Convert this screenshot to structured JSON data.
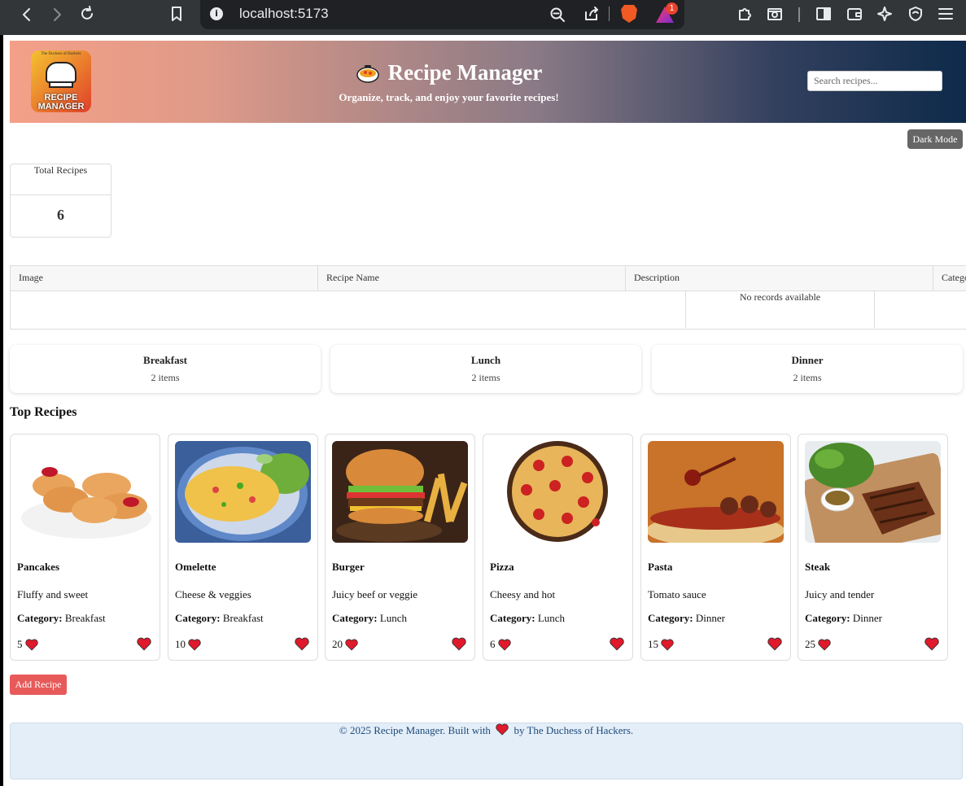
{
  "browser": {
    "url": "localhost:5173",
    "notification_count": "1"
  },
  "header": {
    "logo_small_text": "The Duchess of Hackers",
    "logo_line1": "RECIPE",
    "logo_line2": "MANAGER",
    "title": "Recipe Manager",
    "subtitle": "Organize, track, and enjoy your favorite recipes!",
    "search_placeholder": "Search recipes..."
  },
  "dark_mode_label": "Dark Mode",
  "stats": {
    "label": "Total Recipes",
    "value": "6"
  },
  "table": {
    "columns": [
      "Image",
      "Recipe Name",
      "Description",
      "Category"
    ],
    "empty_text": "No records available"
  },
  "categories": [
    {
      "name": "Breakfast",
      "count": "2 items"
    },
    {
      "name": "Lunch",
      "count": "2 items"
    },
    {
      "name": "Dinner",
      "count": "2 items"
    }
  ],
  "top_title": "Top Recipes",
  "category_label": "Category:",
  "recipes": [
    {
      "name": "Pancakes",
      "desc": "Fluffy and sweet",
      "category": "Breakfast",
      "likes": "5",
      "image": "pancakes"
    },
    {
      "name": "Omelette",
      "desc": "Cheese & veggies",
      "category": "Breakfast",
      "likes": "10",
      "image": "omelette"
    },
    {
      "name": "Burger",
      "desc": "Juicy beef or veggie",
      "category": "Lunch",
      "likes": "20",
      "image": "burger"
    },
    {
      "name": "Pizza",
      "desc": "Cheesy and hot",
      "category": "Lunch",
      "likes": "6",
      "image": "pizza"
    },
    {
      "name": "Pasta",
      "desc": "Tomato sauce",
      "category": "Dinner",
      "likes": "15",
      "image": "pasta"
    },
    {
      "name": "Steak",
      "desc": "Juicy and tender",
      "category": "Dinner",
      "likes": "25",
      "image": "steak"
    }
  ],
  "add_recipe_label": "Add Recipe",
  "footer": {
    "before": "© 2025 Recipe Manager. Built with",
    "after": "by The Duchess of Hackers."
  },
  "colors": {
    "heart": "#e0192b",
    "add_button": "#e85a5a",
    "footer_bg": "#e4eef8"
  }
}
